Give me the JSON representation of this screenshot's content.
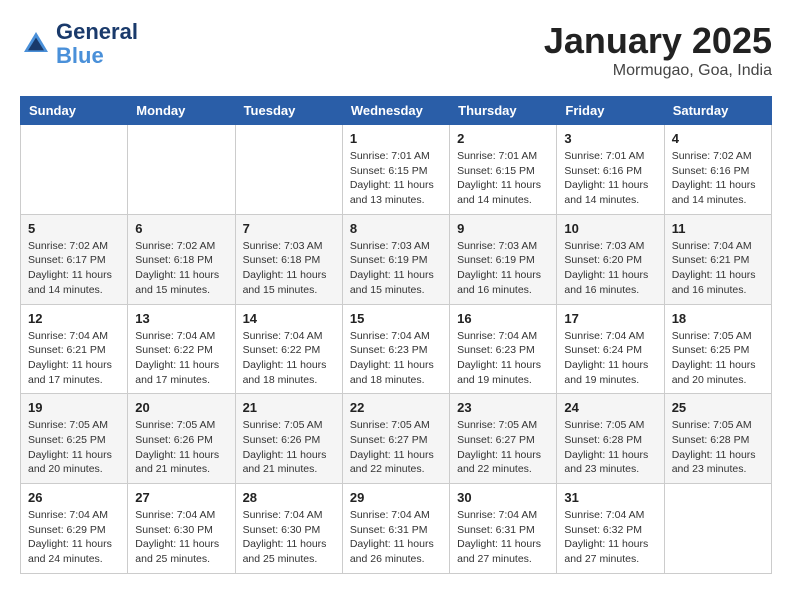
{
  "header": {
    "logo_line1": "General",
    "logo_line2": "Blue",
    "month": "January 2025",
    "location": "Mormugao, Goa, India"
  },
  "weekdays": [
    "Sunday",
    "Monday",
    "Tuesday",
    "Wednesday",
    "Thursday",
    "Friday",
    "Saturday"
  ],
  "weeks": [
    [
      {
        "day": "",
        "info": ""
      },
      {
        "day": "",
        "info": ""
      },
      {
        "day": "",
        "info": ""
      },
      {
        "day": "1",
        "info": "Sunrise: 7:01 AM\nSunset: 6:15 PM\nDaylight: 11 hours\nand 13 minutes."
      },
      {
        "day": "2",
        "info": "Sunrise: 7:01 AM\nSunset: 6:15 PM\nDaylight: 11 hours\nand 14 minutes."
      },
      {
        "day": "3",
        "info": "Sunrise: 7:01 AM\nSunset: 6:16 PM\nDaylight: 11 hours\nand 14 minutes."
      },
      {
        "day": "4",
        "info": "Sunrise: 7:02 AM\nSunset: 6:16 PM\nDaylight: 11 hours\nand 14 minutes."
      }
    ],
    [
      {
        "day": "5",
        "info": "Sunrise: 7:02 AM\nSunset: 6:17 PM\nDaylight: 11 hours\nand 14 minutes."
      },
      {
        "day": "6",
        "info": "Sunrise: 7:02 AM\nSunset: 6:18 PM\nDaylight: 11 hours\nand 15 minutes."
      },
      {
        "day": "7",
        "info": "Sunrise: 7:03 AM\nSunset: 6:18 PM\nDaylight: 11 hours\nand 15 minutes."
      },
      {
        "day": "8",
        "info": "Sunrise: 7:03 AM\nSunset: 6:19 PM\nDaylight: 11 hours\nand 15 minutes."
      },
      {
        "day": "9",
        "info": "Sunrise: 7:03 AM\nSunset: 6:19 PM\nDaylight: 11 hours\nand 16 minutes."
      },
      {
        "day": "10",
        "info": "Sunrise: 7:03 AM\nSunset: 6:20 PM\nDaylight: 11 hours\nand 16 minutes."
      },
      {
        "day": "11",
        "info": "Sunrise: 7:04 AM\nSunset: 6:21 PM\nDaylight: 11 hours\nand 16 minutes."
      }
    ],
    [
      {
        "day": "12",
        "info": "Sunrise: 7:04 AM\nSunset: 6:21 PM\nDaylight: 11 hours\nand 17 minutes."
      },
      {
        "day": "13",
        "info": "Sunrise: 7:04 AM\nSunset: 6:22 PM\nDaylight: 11 hours\nand 17 minutes."
      },
      {
        "day": "14",
        "info": "Sunrise: 7:04 AM\nSunset: 6:22 PM\nDaylight: 11 hours\nand 18 minutes."
      },
      {
        "day": "15",
        "info": "Sunrise: 7:04 AM\nSunset: 6:23 PM\nDaylight: 11 hours\nand 18 minutes."
      },
      {
        "day": "16",
        "info": "Sunrise: 7:04 AM\nSunset: 6:23 PM\nDaylight: 11 hours\nand 19 minutes."
      },
      {
        "day": "17",
        "info": "Sunrise: 7:04 AM\nSunset: 6:24 PM\nDaylight: 11 hours\nand 19 minutes."
      },
      {
        "day": "18",
        "info": "Sunrise: 7:05 AM\nSunset: 6:25 PM\nDaylight: 11 hours\nand 20 minutes."
      }
    ],
    [
      {
        "day": "19",
        "info": "Sunrise: 7:05 AM\nSunset: 6:25 PM\nDaylight: 11 hours\nand 20 minutes."
      },
      {
        "day": "20",
        "info": "Sunrise: 7:05 AM\nSunset: 6:26 PM\nDaylight: 11 hours\nand 21 minutes."
      },
      {
        "day": "21",
        "info": "Sunrise: 7:05 AM\nSunset: 6:26 PM\nDaylight: 11 hours\nand 21 minutes."
      },
      {
        "day": "22",
        "info": "Sunrise: 7:05 AM\nSunset: 6:27 PM\nDaylight: 11 hours\nand 22 minutes."
      },
      {
        "day": "23",
        "info": "Sunrise: 7:05 AM\nSunset: 6:27 PM\nDaylight: 11 hours\nand 22 minutes."
      },
      {
        "day": "24",
        "info": "Sunrise: 7:05 AM\nSunset: 6:28 PM\nDaylight: 11 hours\nand 23 minutes."
      },
      {
        "day": "25",
        "info": "Sunrise: 7:05 AM\nSunset: 6:28 PM\nDaylight: 11 hours\nand 23 minutes."
      }
    ],
    [
      {
        "day": "26",
        "info": "Sunrise: 7:04 AM\nSunset: 6:29 PM\nDaylight: 11 hours\nand 24 minutes."
      },
      {
        "day": "27",
        "info": "Sunrise: 7:04 AM\nSunset: 6:30 PM\nDaylight: 11 hours\nand 25 minutes."
      },
      {
        "day": "28",
        "info": "Sunrise: 7:04 AM\nSunset: 6:30 PM\nDaylight: 11 hours\nand 25 minutes."
      },
      {
        "day": "29",
        "info": "Sunrise: 7:04 AM\nSunset: 6:31 PM\nDaylight: 11 hours\nand 26 minutes."
      },
      {
        "day": "30",
        "info": "Sunrise: 7:04 AM\nSunset: 6:31 PM\nDaylight: 11 hours\nand 27 minutes."
      },
      {
        "day": "31",
        "info": "Sunrise: 7:04 AM\nSunset: 6:32 PM\nDaylight: 11 hours\nand 27 minutes."
      },
      {
        "day": "",
        "info": ""
      }
    ]
  ]
}
